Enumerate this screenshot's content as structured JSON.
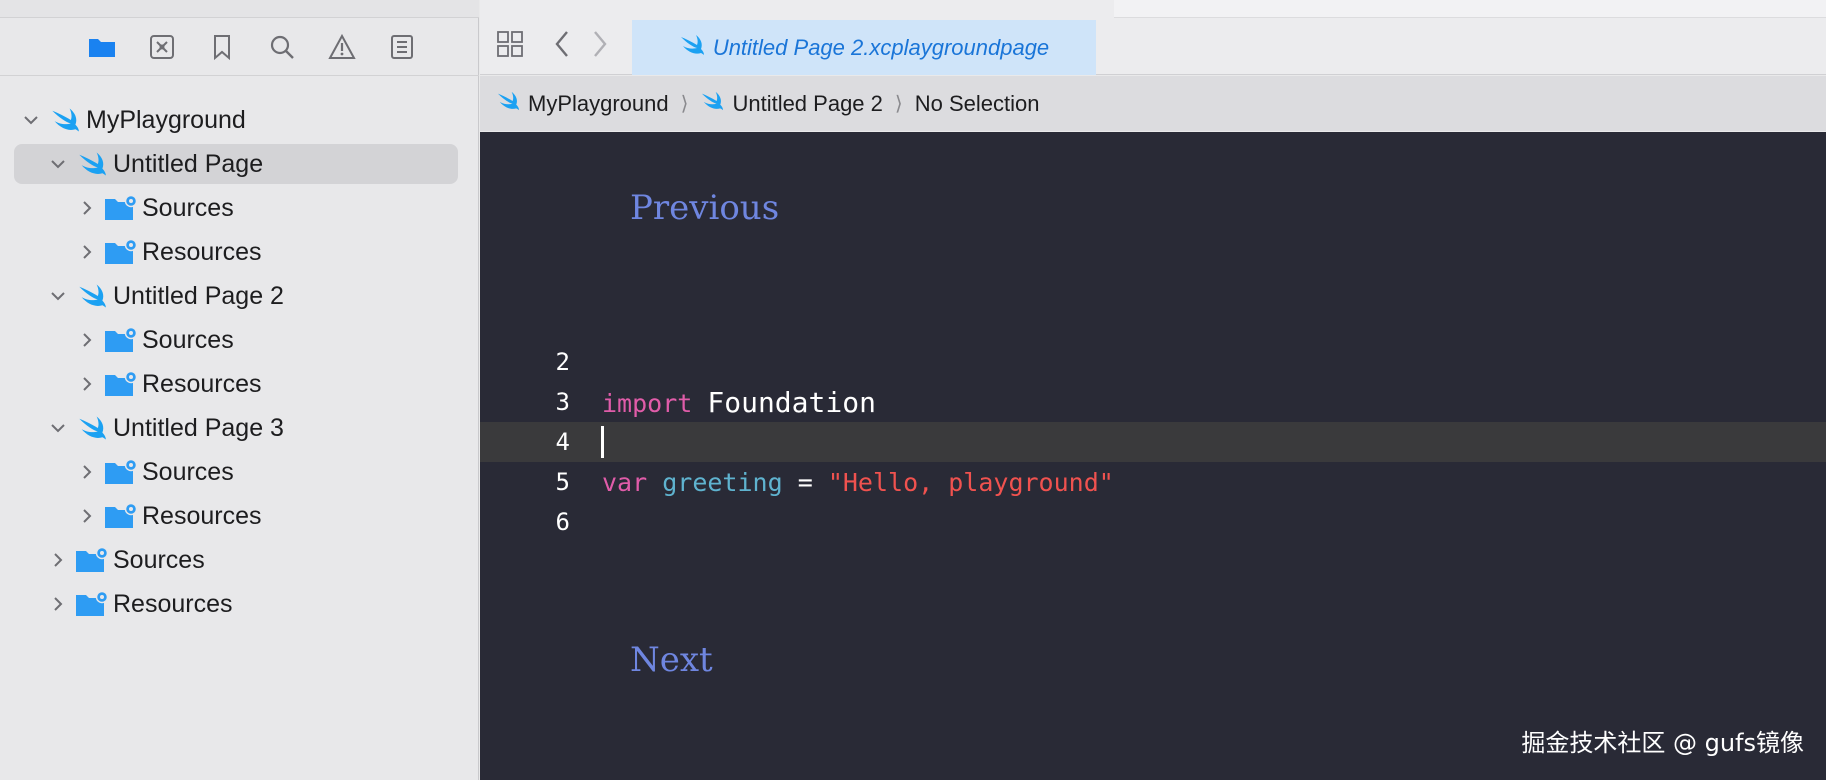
{
  "sidebar": {
    "tree": [
      {
        "label": "MyPlayground",
        "level": 0,
        "icon": "swift-icon",
        "expanded": true,
        "selected": false
      },
      {
        "label": "Untitled Page",
        "level": 1,
        "icon": "swift-icon",
        "expanded": true,
        "selected": true
      },
      {
        "label": "Sources",
        "level": 2,
        "icon": "folder-icon",
        "expanded": false,
        "selected": false
      },
      {
        "label": "Resources",
        "level": 2,
        "icon": "folder-icon",
        "expanded": false,
        "selected": false
      },
      {
        "label": "Untitled Page 2",
        "level": 1,
        "icon": "swift-icon",
        "expanded": true,
        "selected": false
      },
      {
        "label": "Sources",
        "level": 2,
        "icon": "folder-icon",
        "expanded": false,
        "selected": false
      },
      {
        "label": "Resources",
        "level": 2,
        "icon": "folder-icon",
        "expanded": false,
        "selected": false
      },
      {
        "label": "Untitled Page 3",
        "level": 1,
        "icon": "swift-icon",
        "expanded": true,
        "selected": false
      },
      {
        "label": "Sources",
        "level": 2,
        "icon": "folder-icon",
        "expanded": false,
        "selected": false
      },
      {
        "label": "Resources",
        "level": 2,
        "icon": "folder-icon",
        "expanded": false,
        "selected": false
      },
      {
        "label": "Sources",
        "level": 1,
        "icon": "folder-icon",
        "expanded": false,
        "selected": false
      },
      {
        "label": "Resources",
        "level": 1,
        "icon": "folder-icon",
        "expanded": false,
        "selected": false
      }
    ]
  },
  "tab": {
    "title": "Untitled Page 2.xcplaygroundpage"
  },
  "jumpbar": {
    "project": "MyPlayground",
    "page": "Untitled Page 2",
    "selection": "No Selection"
  },
  "editor": {
    "previous_link": "Previous",
    "next_link": "Next",
    "lines": [
      {
        "number": "2"
      },
      {
        "number": "3",
        "keyword": "import",
        "module": "Foundation"
      },
      {
        "number": "4"
      },
      {
        "number": "5",
        "keyword": "var",
        "identifier": "greeting",
        "operator": "=",
        "string": "\"Hello, playground\""
      },
      {
        "number": "6"
      }
    ]
  },
  "watermark": "掘金技术社区 @ gufs镜像",
  "colors": {
    "accent": "#1a75d8",
    "editor_bg": "#292a36",
    "keyword": "#e05ca9",
    "string": "#f0524f",
    "identifier": "#5fb3cf",
    "link": "#6f86e0"
  }
}
